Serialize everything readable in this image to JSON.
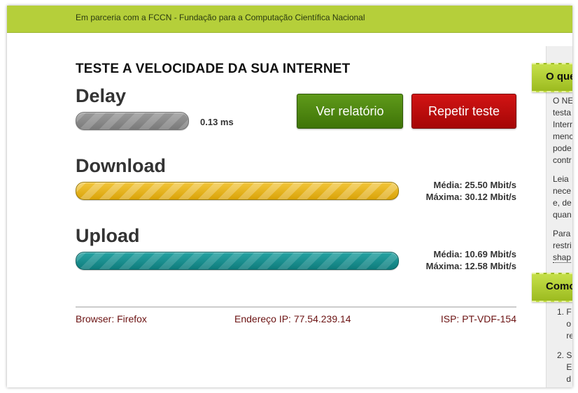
{
  "header": {
    "partner_text": "Em parceria com a FCCN - Fundação para a Computação Científica Nacional"
  },
  "main": {
    "title": "TESTE A VELOCIDADE DA SUA INTERNET",
    "delay": {
      "label": "Delay",
      "value": "0.13 ms"
    },
    "buttons": {
      "report_label": "Ver relatório",
      "repeat_label": "Repetir teste"
    },
    "download": {
      "label": "Download",
      "avg": "Média: 25.50 Mbit/s",
      "max": "Máxima: 30.12 Mbit/s"
    },
    "upload": {
      "label": "Upload",
      "avg": "Média: 10.69 Mbit/s",
      "max": "Máxima: 12.58 Mbit/s"
    }
  },
  "footer": {
    "browser": "Browser: Firefox",
    "ip": "Endereço IP: 77.54.239.14",
    "isp": "ISP: PT-VDF-154"
  },
  "sidebar": {
    "tab1": "O que",
    "tab2": "Como",
    "para1": "O NE\ntesta\nInterr\nmenc\npode\ncontr",
    "para2": "Leia\nnece\ne, de\nquan",
    "para3_line1": "Para",
    "para3_line2": "restri",
    "para3_link": "shap",
    "list1": "1. F\n    o\n    re",
    "list2": "2. S\n    E\n    d"
  },
  "colors": {
    "topbar": "#b5cf3a",
    "report_button": "#4f8a10",
    "repeat_button": "#c00a0a",
    "download_bar": "#e8b517",
    "upload_bar": "#1a9090",
    "delay_bar": "#8a8a8a",
    "footer_text": "#6b1212"
  }
}
